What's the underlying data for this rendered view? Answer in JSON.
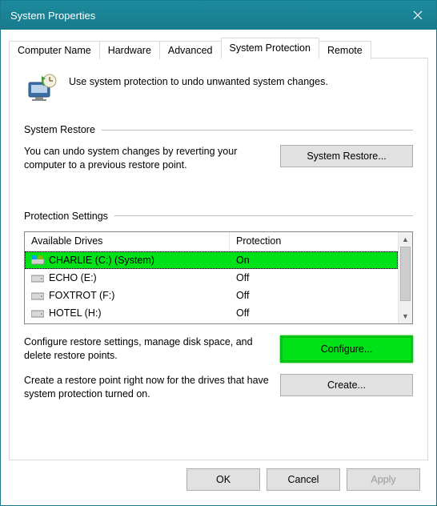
{
  "window": {
    "title": "System Properties"
  },
  "tabs": [
    {
      "label": "Computer Name"
    },
    {
      "label": "Hardware"
    },
    {
      "label": "Advanced"
    },
    {
      "label": "System Protection",
      "active": true
    },
    {
      "label": "Remote"
    }
  ],
  "intro": "Use system protection to undo unwanted system changes.",
  "restore": {
    "header": "System Restore",
    "desc": "You can undo system changes by reverting your computer to a previous restore point.",
    "button": "System Restore..."
  },
  "protection": {
    "header": "Protection Settings",
    "columns": {
      "a": "Available Drives",
      "b": "Protection"
    },
    "drives": [
      {
        "name": "CHARLIE (C:) (System)",
        "protection": "On",
        "system": true,
        "selected": true
      },
      {
        "name": "ECHO (E:)",
        "protection": "Off"
      },
      {
        "name": "FOXTROT (F:)",
        "protection": "Off"
      },
      {
        "name": "HOTEL (H:)",
        "protection": "Off"
      }
    ],
    "configure": {
      "desc": "Configure restore settings, manage disk space, and delete restore points.",
      "button": "Configure..."
    },
    "create": {
      "desc": "Create a restore point right now for the drives that have system protection turned on.",
      "button": "Create..."
    }
  },
  "footer": {
    "ok": "OK",
    "cancel": "Cancel",
    "apply": "Apply"
  }
}
